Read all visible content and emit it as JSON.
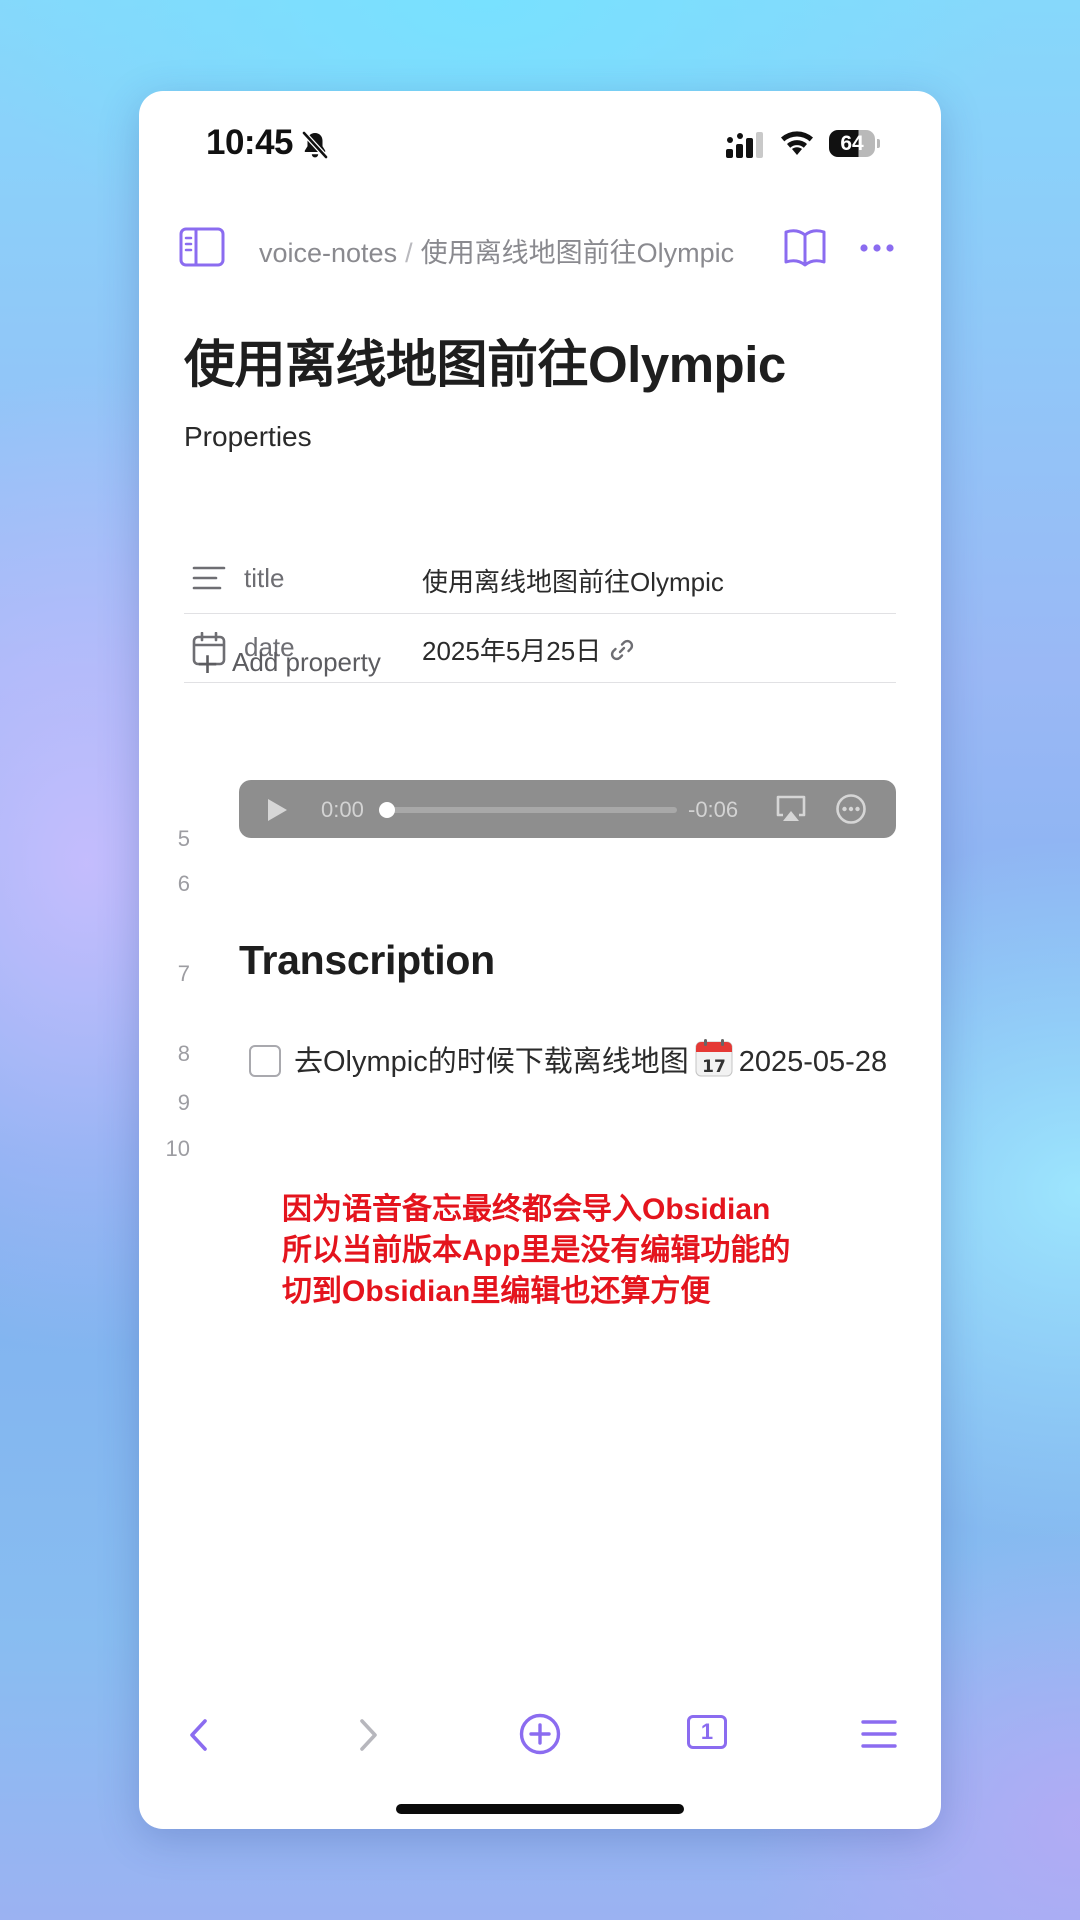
{
  "status_bar": {
    "time": "10:45",
    "battery": "64"
  },
  "breadcrumb": {
    "folder": "voice-notes",
    "separator": "/",
    "note": "使用离线地图前往Olympic"
  },
  "note": {
    "title": "使用离线地图前往Olympic",
    "properties_heading": "Properties",
    "properties": [
      {
        "key": "title",
        "value": "使用离线地图前往Olympic"
      },
      {
        "key": "date",
        "value": "2025年5月25日"
      }
    ],
    "add_property_label": "Add property",
    "line_numbers": [
      "5",
      "6",
      "7",
      "8",
      "9",
      "10"
    ],
    "audio": {
      "current": "0:00",
      "remaining": "-0:06",
      "progress": 0
    },
    "heading": "Transcription",
    "task": {
      "checked": false,
      "text": "去Olympic的时候下载离线地图",
      "date": "2025-05-28"
    }
  },
  "overlay_text": [
    "因为语音备忘最终都会导入Obsidian",
    "所以当前版本App里是没有编辑功能的",
    "切到Obsidian里编辑也还算方便"
  ],
  "colors": {
    "accent": "#8b6cf0",
    "annotation": "#e4141d"
  },
  "icons": [
    "bell-slash-icon",
    "signal-icon",
    "wifi-icon",
    "sidebar-toggle-icon",
    "book-open-icon",
    "more-icon",
    "text-lines-icon",
    "calendar-icon",
    "link-icon",
    "play-icon",
    "airplay-icon",
    "options-icon",
    "calendar-emoji-icon",
    "back-icon",
    "forward-icon",
    "new-note-icon",
    "tabs-icon",
    "menu-icon"
  ],
  "bottom_nav": {
    "tab_count": "1"
  }
}
